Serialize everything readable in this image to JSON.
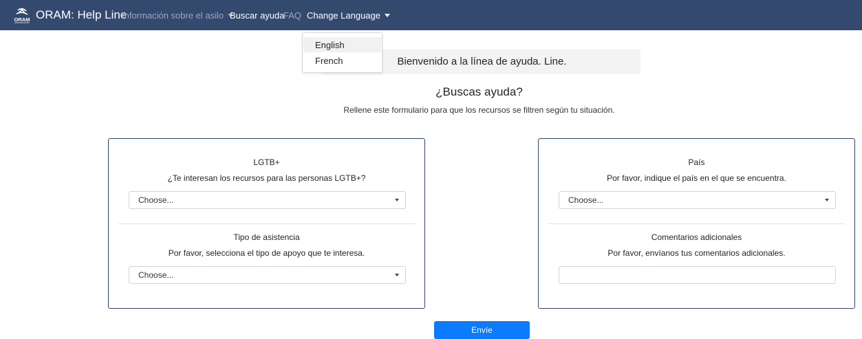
{
  "navbar": {
    "brand_logo_text": "ORAM",
    "brand_title": "ORAM: Help Line",
    "items": [
      {
        "label": "Información sobre el asilo"
      },
      {
        "label": "Buscar ayuda"
      },
      {
        "label": "FAQ"
      },
      {
        "label": "Change Language"
      }
    ]
  },
  "language_menu": {
    "options": [
      "English",
      "French"
    ]
  },
  "banner": {
    "text": "Bienvenido a la línea de ayuda. Line."
  },
  "header": {
    "title": "¿Buscas ayuda?",
    "subtitle": "Rellene este formulario para que los recursos se filtren según tu situación."
  },
  "form": {
    "lgtb": {
      "label": "LGTB+",
      "help": "¿Te interesan los recursos para las personas LGTB+?",
      "selected": "Choose..."
    },
    "assistance": {
      "label": "Tipo de asistencia",
      "help": "Por favor, selecciona el tipo de apoyo que te interesa.",
      "selected": "Choose..."
    },
    "country": {
      "label": "País",
      "help": "Por favor, indique el país en el que se encuentra.",
      "selected": "Choose..."
    },
    "comments": {
      "label": "Comentarios adicionales",
      "help": "Por favor, envíanos tus comentarios adicionales.",
      "value": ""
    },
    "submit_label": "Envíe"
  },
  "colors": {
    "navbar_bg": "#34496e",
    "card_border": "#2e4068",
    "primary_button": "#0b7bff",
    "banner_bg": "#f3f3f3"
  }
}
